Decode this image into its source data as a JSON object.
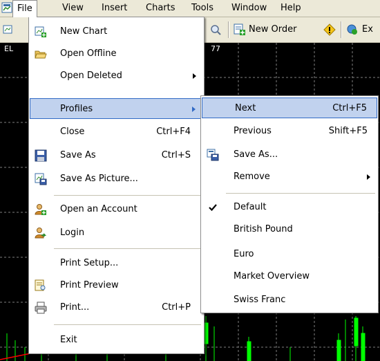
{
  "menubar": {
    "items": [
      {
        "label": "File"
      },
      {
        "label": "View"
      },
      {
        "label": "Insert"
      },
      {
        "label": "Charts"
      },
      {
        "label": "Tools"
      },
      {
        "label": "Window"
      },
      {
        "label": "Help"
      }
    ]
  },
  "toolbar": {
    "new_order_label": "New Order",
    "expert_label": "Ex"
  },
  "chart": {
    "symbol": "EL",
    "price_fragment": "77"
  },
  "file_menu": {
    "items": [
      {
        "label": "New Chart",
        "shortcut": "",
        "icon": "new-chart-icon"
      },
      {
        "label": "Open Offline",
        "shortcut": "",
        "icon": "folder-open-icon"
      },
      {
        "label": "Open Deleted",
        "shortcut": "",
        "icon": ""
      },
      {
        "label": "Profiles",
        "shortcut": "",
        "icon": ""
      },
      {
        "label": "Close",
        "shortcut": "Ctrl+F4",
        "icon": ""
      },
      {
        "label": "Save As",
        "shortcut": "Ctrl+S",
        "icon": "floppy-disk-icon"
      },
      {
        "label": "Save As Picture...",
        "shortcut": "",
        "icon": "save-picture-icon"
      },
      {
        "label": "Open an Account",
        "shortcut": "",
        "icon": "user-add-icon"
      },
      {
        "label": "Login",
        "shortcut": "",
        "icon": "user-login-icon"
      },
      {
        "label": "Print Setup...",
        "shortcut": "",
        "icon": ""
      },
      {
        "label": "Print Preview",
        "shortcut": "",
        "icon": "print-preview-icon"
      },
      {
        "label": "Print...",
        "shortcut": "Ctrl+P",
        "icon": "printer-icon"
      },
      {
        "label": "Exit",
        "shortcut": "",
        "icon": ""
      }
    ]
  },
  "profiles_submenu": {
    "items": [
      {
        "label": "Next",
        "shortcut": "Ctrl+F5"
      },
      {
        "label": "Previous",
        "shortcut": "Shift+F5"
      },
      {
        "label": "Save As...",
        "shortcut": ""
      },
      {
        "label": "Remove",
        "shortcut": ""
      },
      {
        "label": "Default",
        "shortcut": ""
      },
      {
        "label": "British Pound",
        "shortcut": ""
      },
      {
        "label": "Euro",
        "shortcut": ""
      },
      {
        "label": "Market Overview",
        "shortcut": ""
      },
      {
        "label": "Swiss Franc",
        "shortcut": ""
      }
    ]
  },
  "colors": {
    "highlight_bg": "#c1d2ee",
    "highlight_border": "#316ac5",
    "chrome": "#ece9d8",
    "chart_bg": "#000000",
    "candle": "#00ff00",
    "ma_line": "#ff0000"
  }
}
